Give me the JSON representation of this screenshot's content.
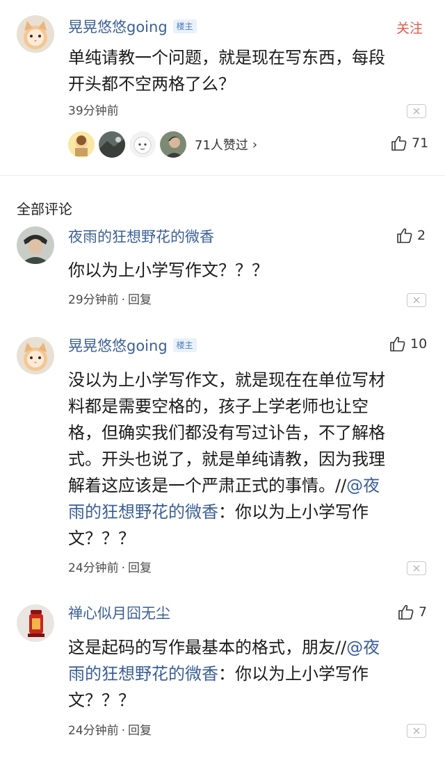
{
  "post": {
    "author": "晃晃悠悠going",
    "badge": "楼主",
    "follow_label": "关注",
    "text_lines": [
      "单纯请教一个问题，就是现在写东西，每段",
      "开头都不空两格了么？"
    ],
    "time": "39分钟前",
    "likers_text": "71人赞过",
    "likers_chevron": "›",
    "like_count": "71"
  },
  "section_title": "全部评论",
  "reply_label": "回复",
  "comments": [
    {
      "author": "夜雨的狂想野花的微香",
      "likes": "2",
      "text_lines": [
        "你以为上小学写作文？？？"
      ],
      "time": "29分钟前"
    },
    {
      "author": "晃晃悠悠going",
      "badge": "楼主",
      "likes": "10",
      "text_lines": [
        "没以为上小学写作文，就是现在在单位写材",
        "料都是需要空格的，孩子上学老师也让空",
        "格，但确实我们都没有写过讣告，不了解格",
        "式。开头也说了，就是单纯请教，因为我理"
      ],
      "line5_plain": "解着这应该是一个严肃正式的事情。//",
      "line5_link": "@夜",
      "line6_link": "雨的狂想野花的微香",
      "line6_plain": "：你以为上小学写作",
      "line7": "文？？？",
      "time": "24分钟前"
    },
    {
      "author": "禅心似月囧无尘",
      "likes": "7",
      "line1_plain": "这是起码的写作最基本的格式，朋友//",
      "line1_link": "@夜",
      "line2_link": "雨的狂想野花的微香",
      "line2_plain": "：你以为上小学写作",
      "line3": "文？？？",
      "time": "24分钟前"
    }
  ],
  "icons": {
    "like": "thumbs-up-icon",
    "close": "close-icon",
    "chevron": "chevron-right-icon"
  },
  "colors": {
    "username": "#3a5f97",
    "follow": "#e4574c",
    "badge_bg": "#e9f1fb",
    "badge_text": "#4d7cc0"
  }
}
